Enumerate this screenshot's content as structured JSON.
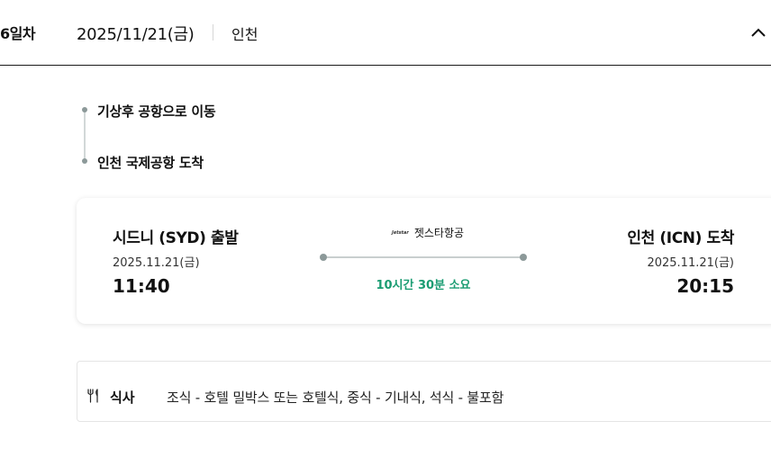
{
  "header": {
    "day_label": "6일차",
    "date": "2025/11/21(금)",
    "city": "인천"
  },
  "timeline": {
    "items": [
      "기상후 공항으로 이동",
      "인천 국제공항 도착"
    ]
  },
  "flight": {
    "departure": {
      "title": "시드니 (SYD) 출발",
      "date": "2025.11.21(금)",
      "time": "11:40"
    },
    "arrival": {
      "title": "인천 (ICN) 도착",
      "date": "2025.11.21(금)",
      "time": "20:15"
    },
    "airline": {
      "logo_text": "Jetstar",
      "name": "젯스타항공"
    },
    "duration": "10시간 30분 소요"
  },
  "meal": {
    "label": "식사",
    "value": "조식 - 호텔 밀박스 또는 호텔식, 중식 - 기내식, 석식 - 불포함",
    "icon": "fork-knife-icon"
  },
  "colors": {
    "accent_green": "#1a9c72",
    "timeline_dot": "#8c9999"
  }
}
